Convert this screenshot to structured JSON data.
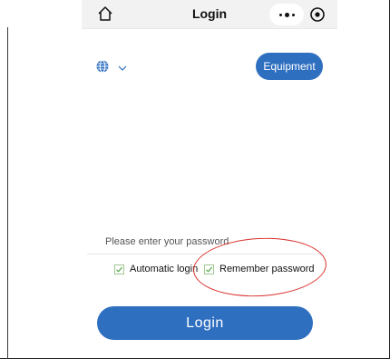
{
  "navbar": {
    "title": "Login",
    "home_icon": "home-icon",
    "more_icon": "more-dots-icon",
    "target_icon": "target-icon"
  },
  "language": {
    "icon": "globe-icon",
    "dropdown_icon": "chevron-down-icon"
  },
  "equipment_button": {
    "label": "Equipment"
  },
  "password": {
    "placeholder": "Please enter your password",
    "value": ""
  },
  "options": {
    "automatic_login": {
      "label": "Automatic login",
      "checked": true
    },
    "remember_password": {
      "label": "Remember password",
      "checked": true
    }
  },
  "login_button": {
    "label": "Login"
  },
  "colors": {
    "primary": "#2f6fc0",
    "checkbox_border": "#a0c890",
    "annotation": "#d9302c"
  }
}
